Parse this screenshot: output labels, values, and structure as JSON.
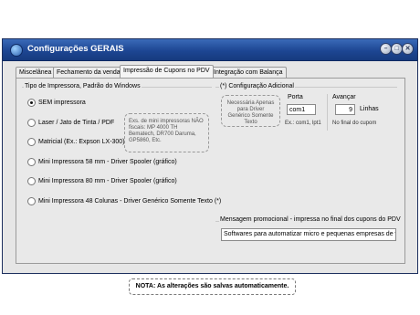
{
  "window": {
    "title": "Configurações GERAIS",
    "controls": [
      "minimize",
      "restore",
      "close"
    ]
  },
  "tabs": [
    {
      "label": "Miscelânea",
      "active": false
    },
    {
      "label": "Fechamento da venda",
      "active": false
    },
    {
      "label": "Impressão de Cupons no PDV",
      "active": true
    },
    {
      "label": "Integração com Balança",
      "active": false
    }
  ],
  "printer_group": {
    "title": "Tipo de Impressora, Padrão do Windows",
    "options": [
      {
        "label": "SEM impressora",
        "checked": true
      },
      {
        "label": "Laser / Jato de Tinta / PDF",
        "checked": false
      },
      {
        "label": "Matricial (Ex.: Expson LX-300)",
        "checked": false
      },
      {
        "label": "Mini Impressora 58 mm - Driver Spooler (gráfico)",
        "checked": false
      },
      {
        "label": "Mini Impressora 80 mm - Driver Spooler (gráfico)",
        "checked": false
      },
      {
        "label": "Mini Impressora 48 Colunas - Driver Genérico Somente Texto (*)",
        "checked": false
      }
    ],
    "examples_note": "Exs. de mini impressoras NÃO fiscais: MP 4000 TH Bematech, DR700 Daruma, GP5860, Etc."
  },
  "additional_config": {
    "title": "(*) Configuração Adicional",
    "generic_note": "Necessária Apenas para Driver Genérico Somente Texto",
    "port": {
      "label": "Porta",
      "value": "com1",
      "hint": "Ex.: com1, lpt1"
    },
    "advance": {
      "label": "Avançar",
      "value": "9",
      "unit": "Linhas",
      "hint": "No final do cupom"
    }
  },
  "promo": {
    "title": "Mensagem promocional - impressa no final dos cupons do PDV",
    "value": "Softwares para automatizar micro e pequenas empresas de vário"
  },
  "footer_note": "NOTA: As alterações são salvas automaticamente.",
  "colors": {
    "titlebar": "#1d4693",
    "window_bg": "#e6e6e6",
    "border": "#1c2f5e"
  }
}
